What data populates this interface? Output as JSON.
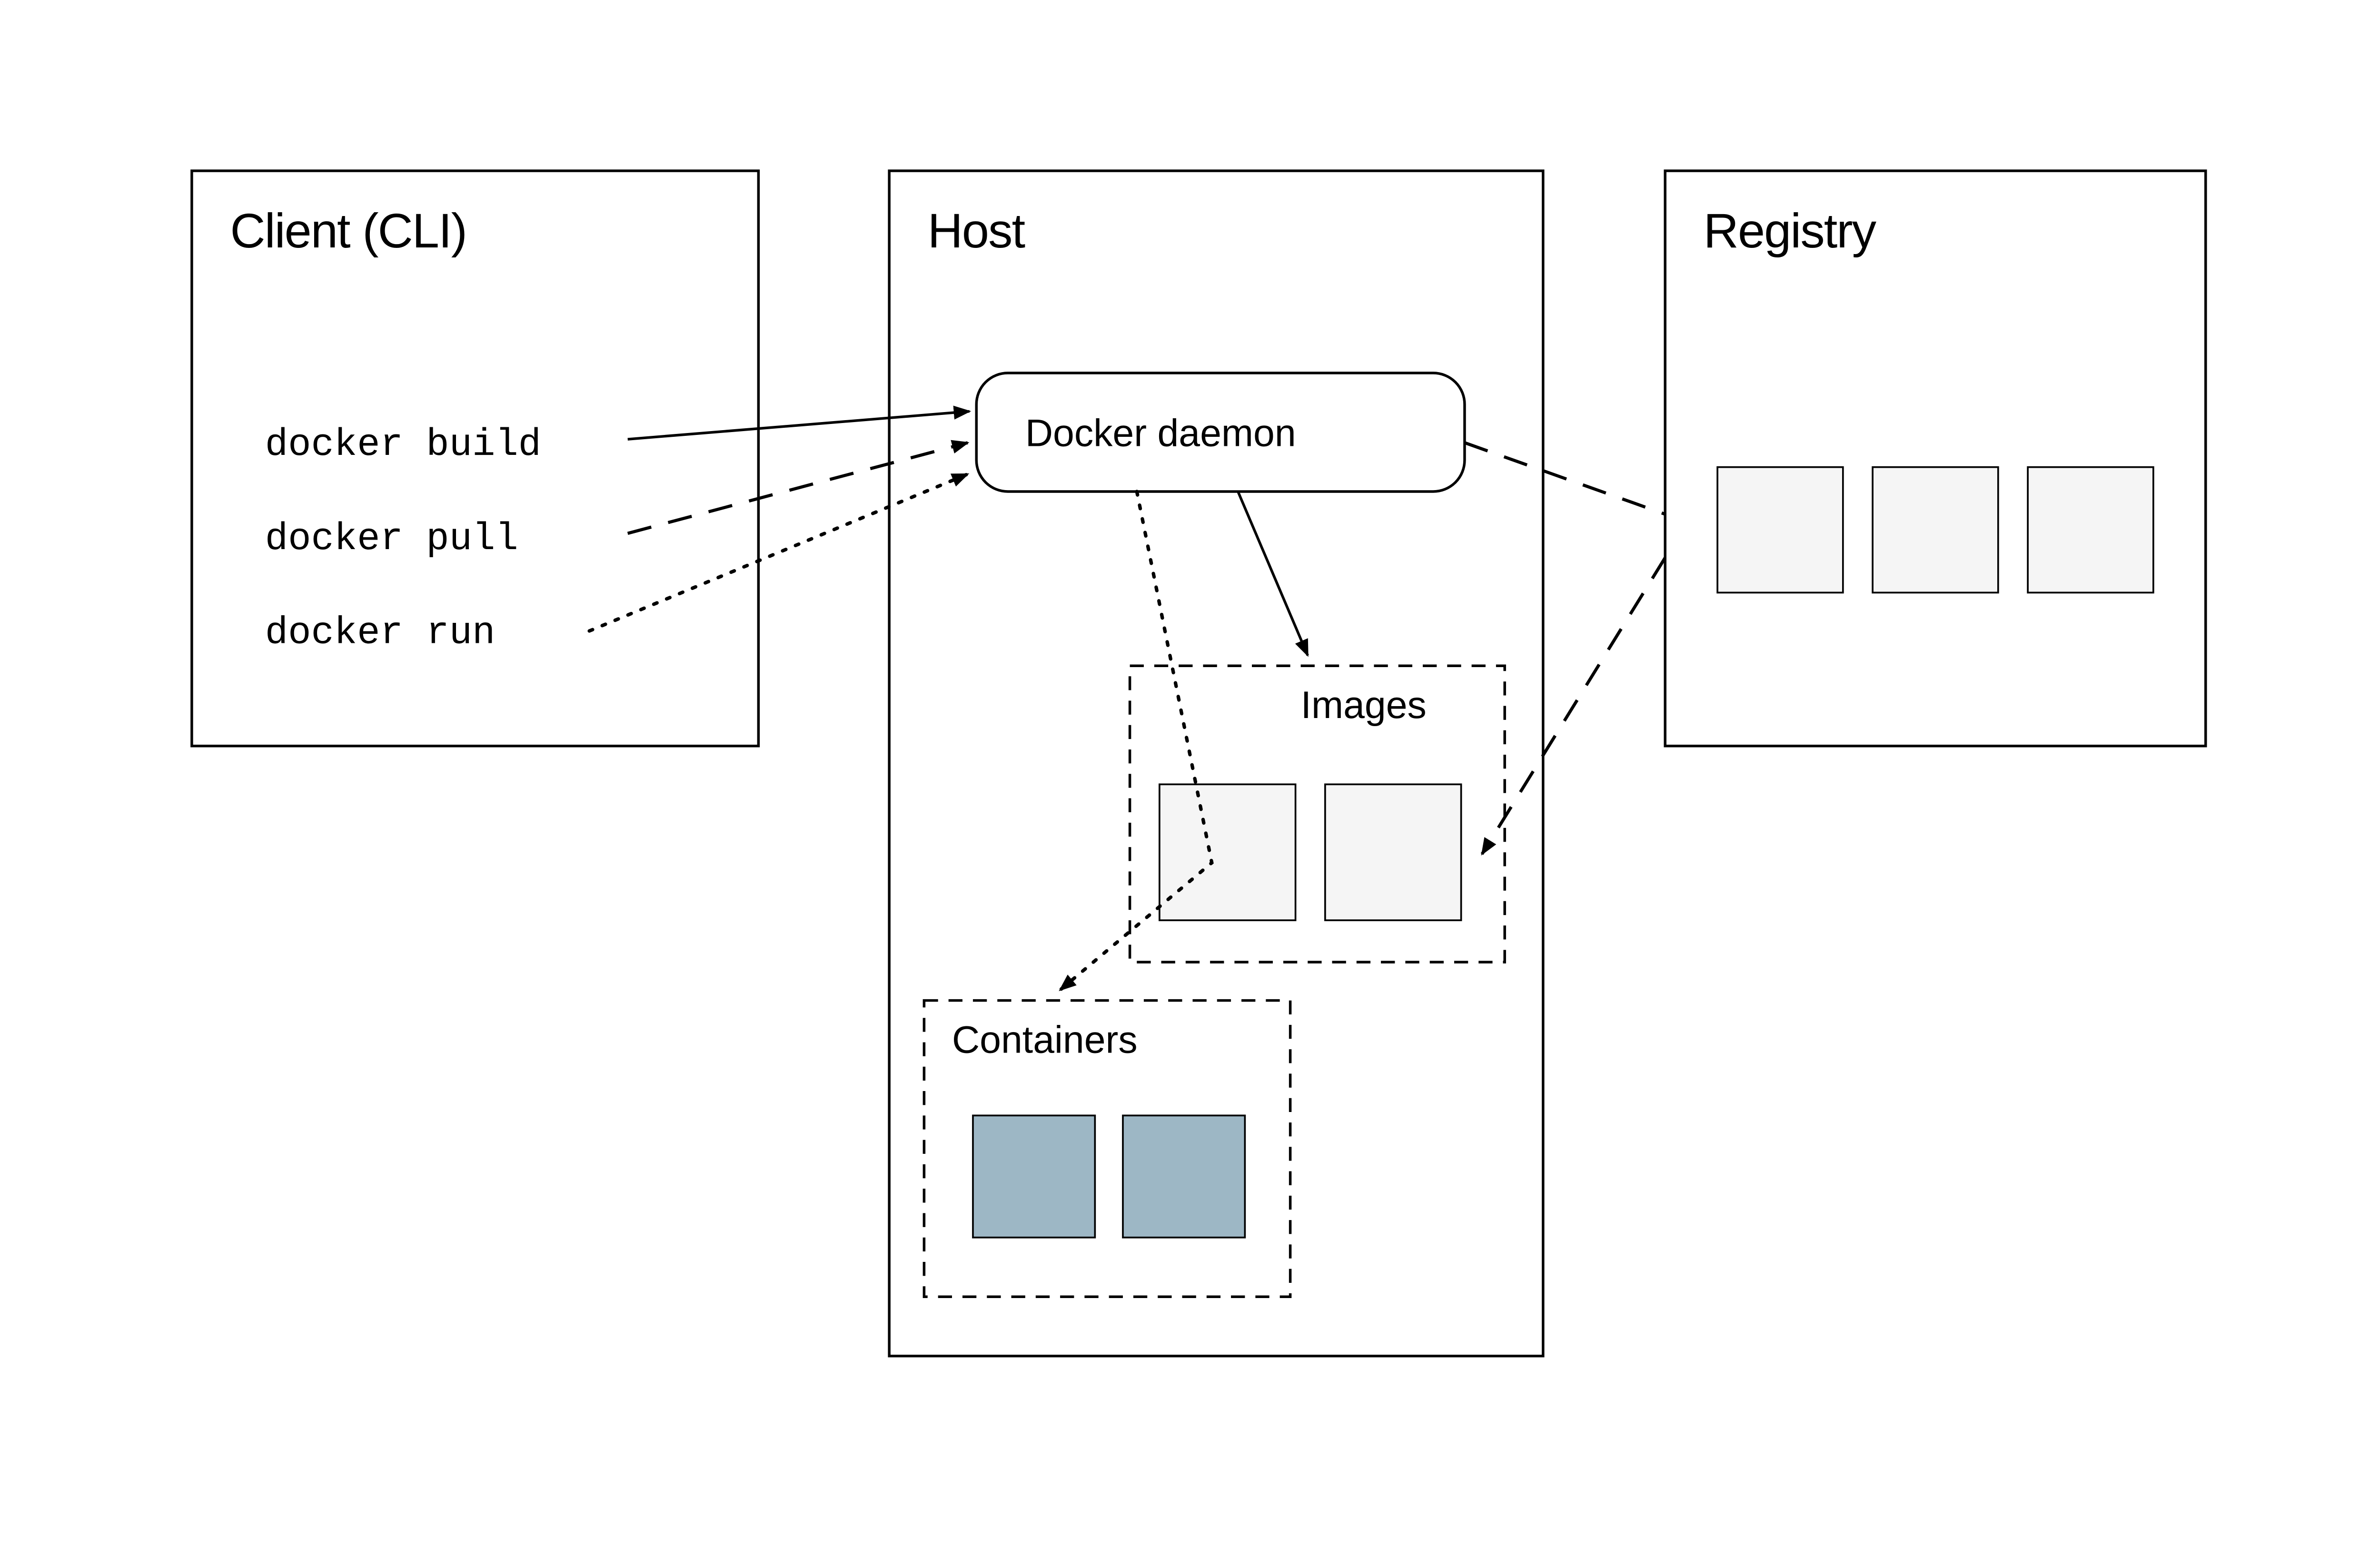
{
  "client": {
    "title": "Client (CLI)",
    "commands": [
      "docker build",
      "docker pull",
      "docker run"
    ]
  },
  "host": {
    "title": "Host",
    "daemon_label": "Docker daemon",
    "images_label": "Images",
    "containers_label": "Containers"
  },
  "registry": {
    "title": "Registry"
  },
  "arrows": {
    "build_to_daemon": "solid",
    "pull_to_daemon": "dashed",
    "run_to_daemon": "dotted",
    "daemon_to_images": "solid",
    "daemon_to_containers": "dotted",
    "daemon_to_registry_out": "dashed",
    "registry_to_images_in": "dashed"
  }
}
